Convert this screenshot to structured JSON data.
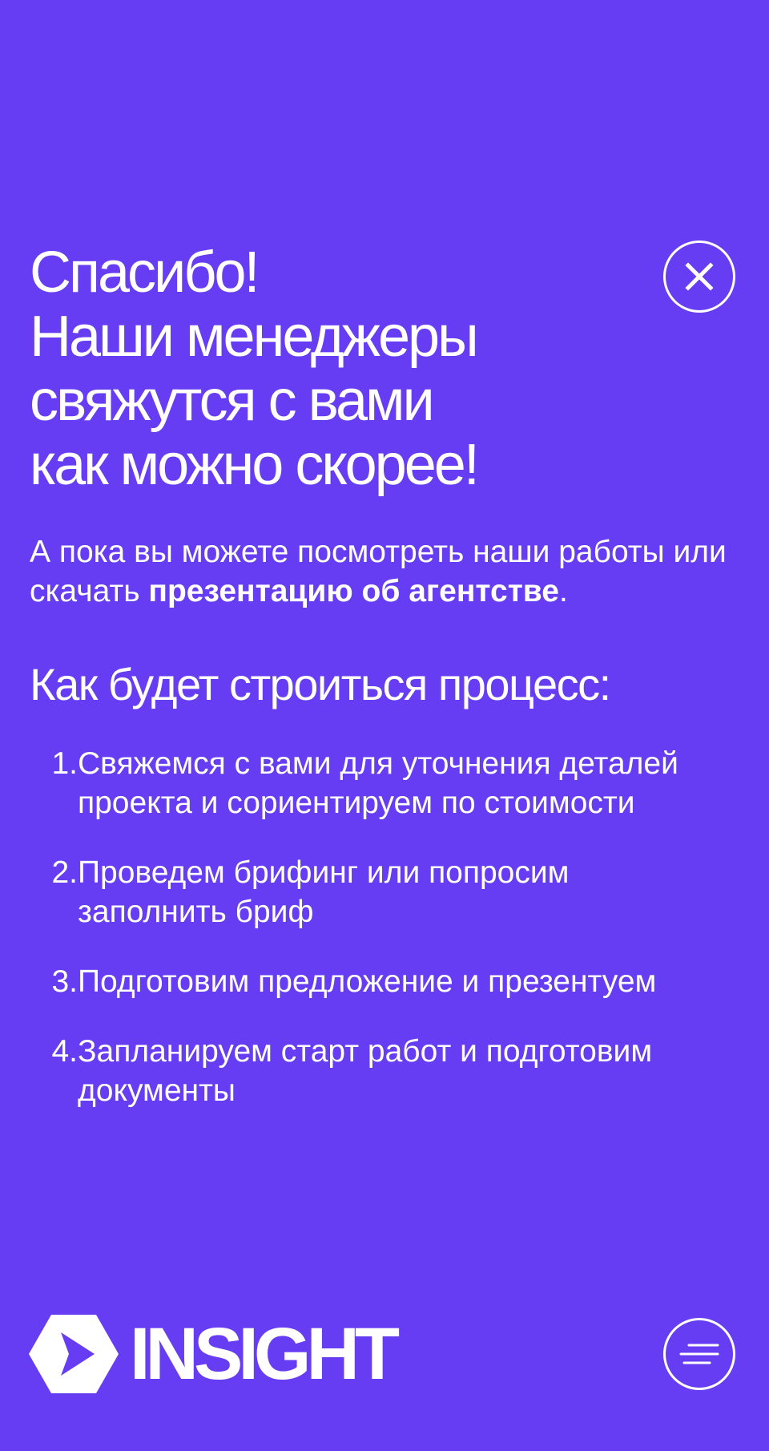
{
  "title": {
    "lines": [
      "Спасибо!",
      "Наши менеджеры",
      "свяжутся с вами",
      "как можно скорее!"
    ]
  },
  "intro": {
    "text": "А пока вы можете посмотреть наши работы или скачать ",
    "link_label": "презентацию об агентстве",
    "suffix": "."
  },
  "process": {
    "title": "Как будет строиться процесс:",
    "steps": [
      {
        "number": "1.",
        "text": "Свяжемся с вами для уточнения деталей проекта и сориентируем по стоимости"
      },
      {
        "number": "2.",
        "text": "Проведем брифинг или попросим заполнить бриф"
      },
      {
        "number": "3.",
        "text": "Подготовим предложение и презентуем"
      },
      {
        "number": "4.",
        "text": "Запланируем старт работ и подготовим документы"
      }
    ]
  },
  "footer": {
    "logo_text": "INSIGHT"
  },
  "icons": {
    "close": "close-icon",
    "menu": "menu-icon",
    "logo": "insight-logo-icon"
  },
  "colors": {
    "background": "#673DF3",
    "text": "#FFFFFF"
  }
}
